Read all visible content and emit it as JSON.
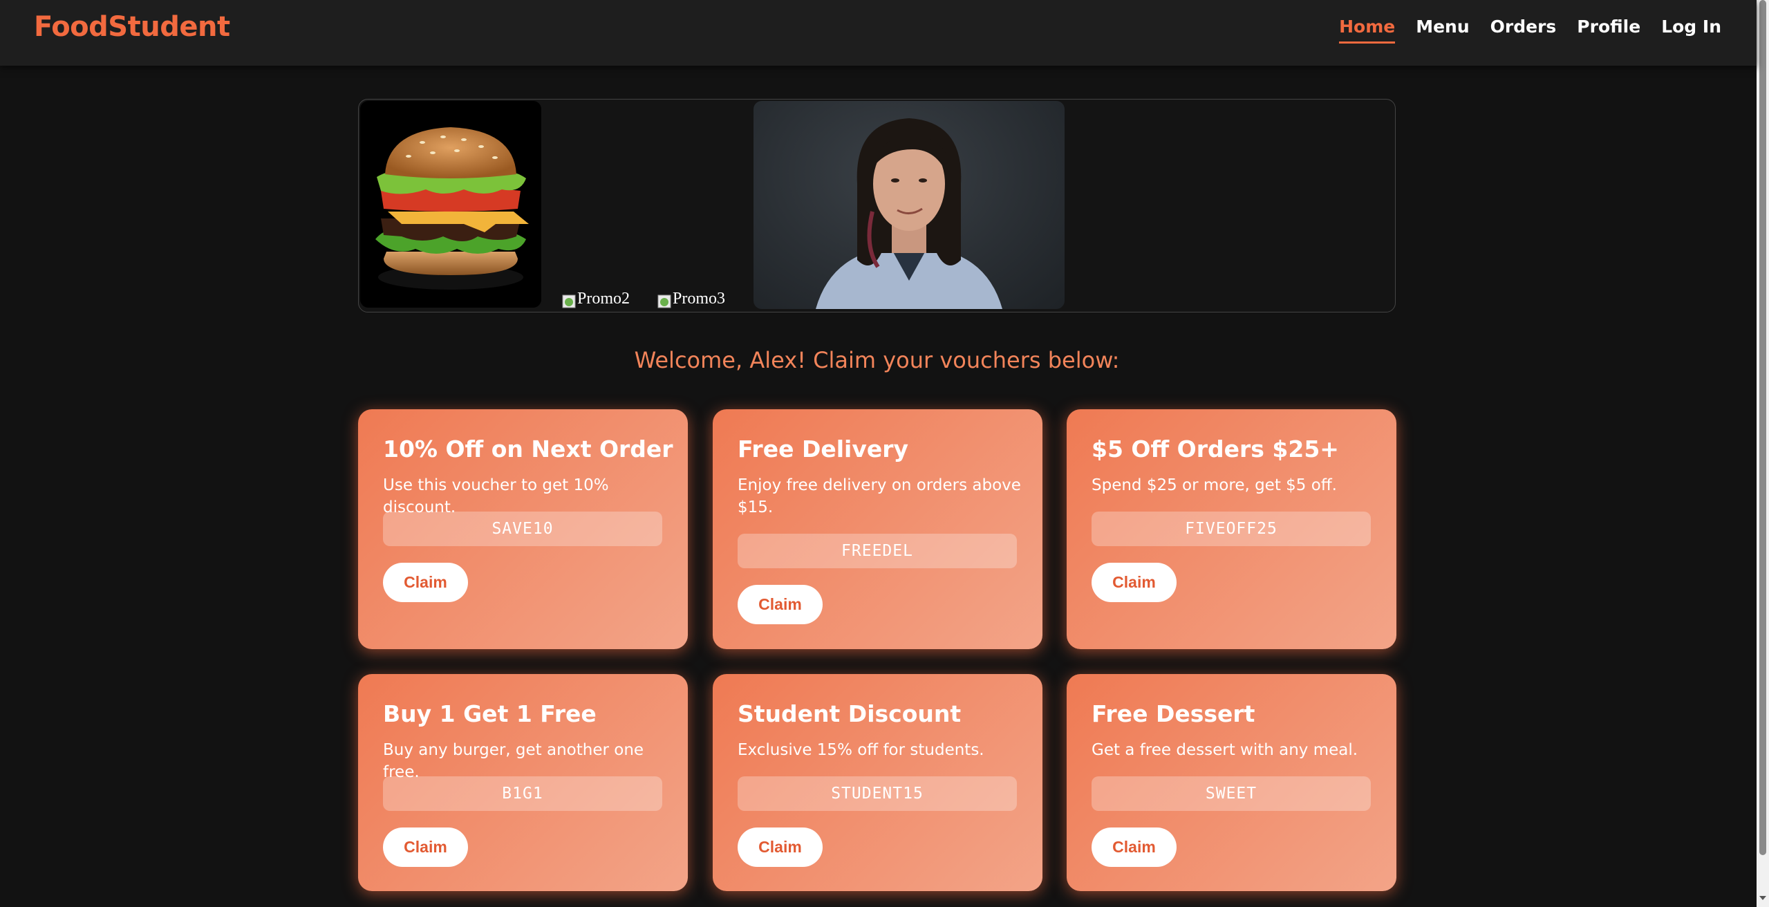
{
  "header": {
    "logo": "FoodStudent",
    "nav": [
      "Home",
      "Menu",
      "Orders",
      "Profile",
      "Log In"
    ],
    "active_nav": "Home"
  },
  "carousel": {
    "slides": [
      {
        "alt": "Promo2"
      },
      {
        "alt": "Promo3"
      }
    ]
  },
  "welcome": "Welcome, Alex! Claim your vouchers below:",
  "vouchers": [
    {
      "title": "10% Off on Next Order",
      "desc": "Use this voucher to get 10% discount.",
      "code": "SAVE10",
      "button": "Claim"
    },
    {
      "title": "Free Delivery",
      "desc": "Enjoy free delivery on orders above $15.",
      "code": "FREEDEL",
      "button": "Claim"
    },
    {
      "title": "$5 Off Orders $25+",
      "desc": "Spend $25 or more, get $5 off.",
      "code": "FIVEOFF25",
      "button": "Claim"
    },
    {
      "title": "Buy 1 Get 1 Free",
      "desc": "Buy any burger, get another one free.",
      "code": "B1G1",
      "button": "Claim"
    },
    {
      "title": "Student Discount",
      "desc": "Exclusive 15% off for students.",
      "code": "STUDENT15",
      "button": "Claim"
    },
    {
      "title": "Free Dessert",
      "desc": "Get a free dessert with any meal.",
      "code": "SWEET",
      "button": "Claim"
    }
  ],
  "colors": {
    "accent": "#f26a3f",
    "background": "#121212",
    "header": "#1e1e1e",
    "card_start": "#ef7a53",
    "card_end": "#f3a488"
  }
}
